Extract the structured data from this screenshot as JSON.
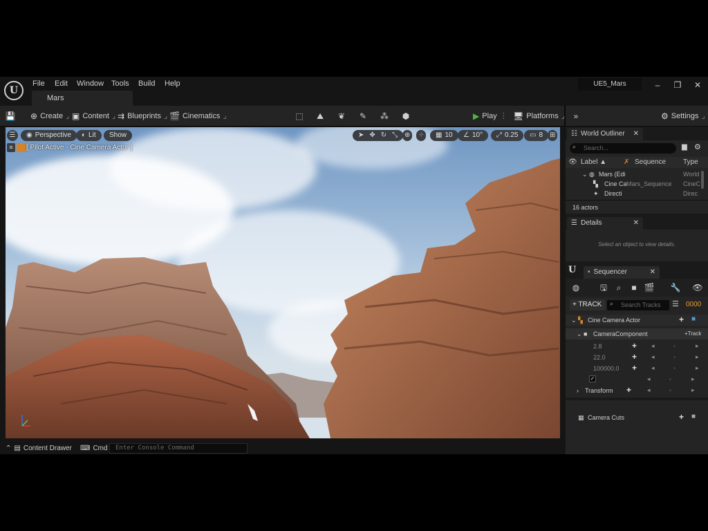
{
  "menu": {
    "items": [
      "File",
      "Edit",
      "Window",
      "Tools",
      "Build",
      "Help"
    ],
    "level_tab": "Mars",
    "project_name": "UE5_Mars"
  },
  "toolbar": {
    "create": "Create",
    "content": "Content",
    "blueprints": "Blueprints",
    "cinematics": "Cinematics",
    "play": "Play",
    "platforms": "Platforms",
    "settings": "Settings"
  },
  "viewport": {
    "perspective": "Perspective",
    "lit": "Lit",
    "show": "Show",
    "pilot_label": "[ Pilot Active - Cine Camera Actor ]",
    "grid_snap": "10",
    "rotation_snap": "10°",
    "scale_snap": "0.25",
    "camera_speed": "8"
  },
  "bottom": {
    "content_drawer": "Content Drawer",
    "cmd": "Cmd",
    "console_placeholder": "Enter Console Command"
  },
  "outliner": {
    "tab": "World Outliner",
    "search_placeholder": "Search...",
    "col_label": "Label ▲",
    "col_sequence": "Sequence",
    "col_type": "Type",
    "rows": [
      {
        "label": "Mars (Edi",
        "sequence": "",
        "type": "World"
      },
      {
        "label": "Cine Ca",
        "sequence": "Mars_Sequence",
        "type": "CineC"
      },
      {
        "label": "Directi",
        "sequence": "",
        "type": "Direc"
      }
    ],
    "count": "16 actors"
  },
  "details": {
    "tab": "Details",
    "hint": "Select an object to view details."
  },
  "sequencer": {
    "tab": "Sequencer",
    "track_button": "TRACK",
    "search_placeholder": "Search Tracks",
    "frame": "0000",
    "actor": "Cine Camera Actor",
    "component": "CameraComponent",
    "component_track": "Track",
    "values": [
      "2.8",
      "22.0",
      "100000.0"
    ],
    "transform": "Transform",
    "camera_cuts": "Camera Cuts"
  },
  "colors": {
    "accent_orange": "#d4842a",
    "play_green": "#4fb33f",
    "frame_orange": "#e8a030"
  }
}
